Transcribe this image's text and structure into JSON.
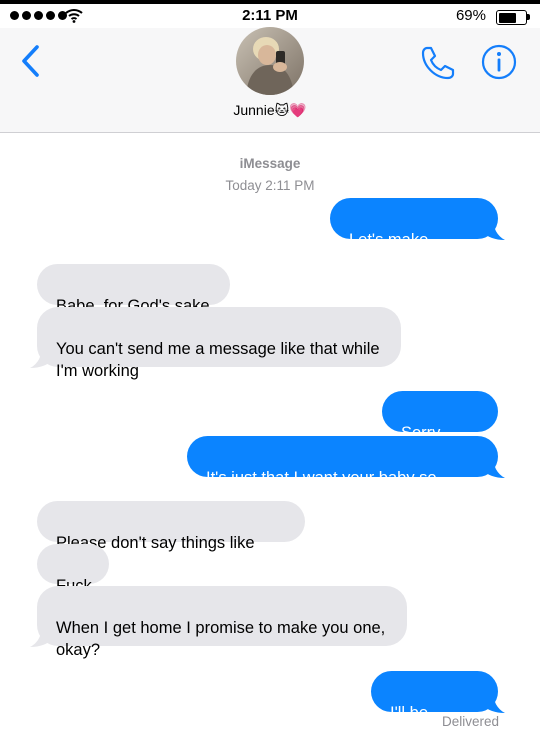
{
  "status_bar": {
    "time": "2:11 PM",
    "battery_percent": "69%",
    "battery_level": 0.69,
    "signal_bars": 5,
    "wifi_icon": "wifi-icon"
  },
  "header": {
    "contact_name": "Junnie🐱💗",
    "back_icon": "chevron-left-icon",
    "call_icon": "phone-icon",
    "info_icon": "info-icon"
  },
  "conversation": {
    "service": "iMessage",
    "timestamp": "Today 2:11 PM",
    "messages": [
      {
        "direction": "outgoing",
        "text": "Let's make babies"
      },
      {
        "direction": "incoming",
        "text": "Babe, for God's sake"
      },
      {
        "direction": "incoming",
        "text": "You can't send me a message like that while\nI'm working"
      },
      {
        "direction": "outgoing",
        "text": "Sorry baby"
      },
      {
        "direction": "outgoing",
        "text": "It's just that I want your baby so much"
      },
      {
        "direction": "incoming",
        "text": "Please don't say things like that"
      },
      {
        "direction": "incoming",
        "text": "Fuck"
      },
      {
        "direction": "incoming",
        "text": "When I get home I promise to make you one,\nokay?"
      },
      {
        "direction": "outgoing",
        "text": "I'll be waiting"
      }
    ],
    "delivery_status": "Delivered"
  },
  "colors": {
    "outgoing_bubble": "#0b84ff",
    "incoming_bubble": "#e6e6ea",
    "accent": "#147efb",
    "meta_text": "#8e8e93"
  }
}
